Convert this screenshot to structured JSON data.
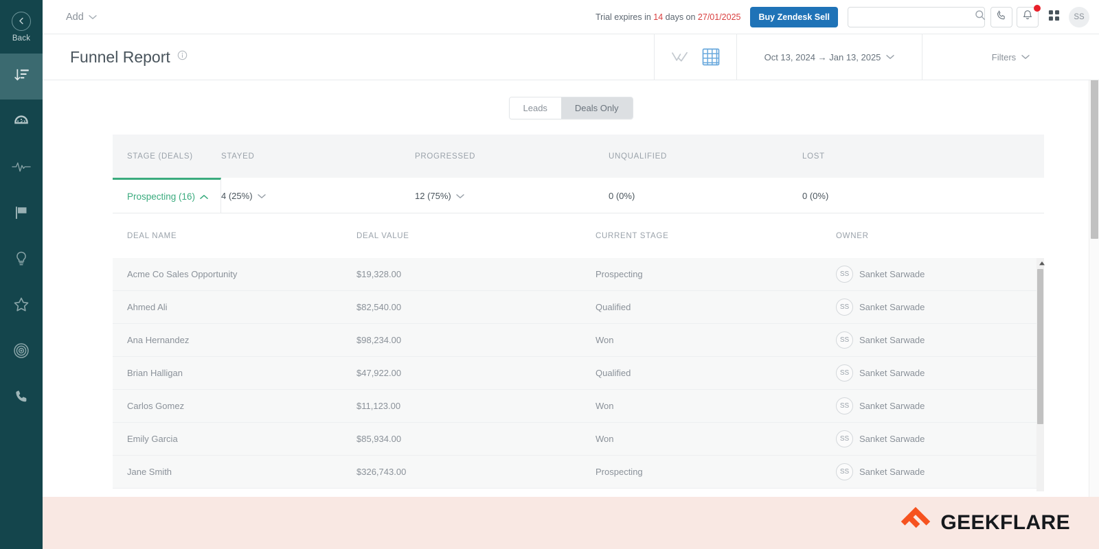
{
  "sidebar": {
    "back_label": "Back",
    "items": [
      {
        "name": "sort-descending-icon",
        "icon": "sort-descending",
        "active": true
      },
      {
        "name": "dashboard-gauge-icon",
        "icon": "gauge",
        "active": false
      },
      {
        "name": "activity-pulse-icon",
        "icon": "pulse",
        "active": false
      },
      {
        "name": "flag-icon",
        "icon": "flag",
        "active": false
      },
      {
        "name": "lightbulb-icon",
        "icon": "lightbulb",
        "active": false
      },
      {
        "name": "star-icon",
        "icon": "star",
        "active": false
      },
      {
        "name": "target-icon",
        "icon": "target",
        "active": false
      },
      {
        "name": "phone-icon",
        "icon": "phone",
        "active": false
      }
    ]
  },
  "topbar": {
    "add_label": "Add",
    "trial_prefix": "Trial expires in ",
    "trial_days": "14",
    "trial_mid": " days on ",
    "trial_date": "27/01/2025",
    "buy_label": "Buy Zendesk Sell",
    "search_value": "",
    "search_placeholder": "",
    "avatar_initials": "SS"
  },
  "report": {
    "title": "Funnel Report",
    "date_range": "Oct 13, 2024 → Jan 13, 2025",
    "filters_label": "Filters",
    "view_chart_active": false,
    "view_table_active": true
  },
  "segmented": {
    "options": [
      {
        "label": "Leads",
        "active": false
      },
      {
        "label": "Deals Only",
        "active": true
      }
    ]
  },
  "funnel_table": {
    "columns": [
      "STAGE (DEALS)",
      "STAYED",
      "PROGRESSED",
      "UNQUALIFIED",
      "LOST"
    ],
    "rows": [
      {
        "stage": "Prospecting (16)",
        "expanded": true,
        "stayed": "4 (25%)",
        "stayed_expandable": true,
        "progressed": "12 (75%)",
        "progressed_expandable": true,
        "unqualified": "0 (0%)",
        "unqualified_expandable": false,
        "lost": "0 (0%)",
        "lost_expandable": false
      }
    ]
  },
  "deal_table": {
    "columns": [
      "DEAL NAME",
      "DEAL VALUE",
      "CURRENT STAGE",
      "OWNER"
    ],
    "rows": [
      {
        "name": "Acme Co Sales Opportunity",
        "value": "$19,328.00",
        "stage": "Prospecting",
        "owner": "Sanket Sarwade",
        "owner_initials": "SS"
      },
      {
        "name": "Ahmed Ali",
        "value": "$82,540.00",
        "stage": "Qualified",
        "owner": "Sanket Sarwade",
        "owner_initials": "SS"
      },
      {
        "name": "Ana Hernandez",
        "value": "$98,234.00",
        "stage": "Won",
        "owner": "Sanket Sarwade",
        "owner_initials": "SS"
      },
      {
        "name": "Brian Halligan",
        "value": "$47,922.00",
        "stage": "Qualified",
        "owner": "Sanket Sarwade",
        "owner_initials": "SS"
      },
      {
        "name": "Carlos Gomez",
        "value": "$11,123.00",
        "stage": "Won",
        "owner": "Sanket Sarwade",
        "owner_initials": "SS"
      },
      {
        "name": "Emily Garcia",
        "value": "$85,934.00",
        "stage": "Won",
        "owner": "Sanket Sarwade",
        "owner_initials": "SS"
      },
      {
        "name": "Jane Smith",
        "value": "$326,743.00",
        "stage": "Prospecting",
        "owner": "Sanket Sarwade",
        "owner_initials": "SS"
      }
    ]
  },
  "watermark": {
    "text": "GEEKFLARE"
  },
  "colors": {
    "sidebar_bg": "#14454c",
    "sidebar_active": "#3b6a70",
    "accent_green": "#3aab7e",
    "brand_blue": "#1f73b7",
    "alert_red": "#e8202a",
    "trial_red": "#d93f3f",
    "watermark_orange": "#f6521f",
    "footer_band": "#f9e8e3"
  }
}
